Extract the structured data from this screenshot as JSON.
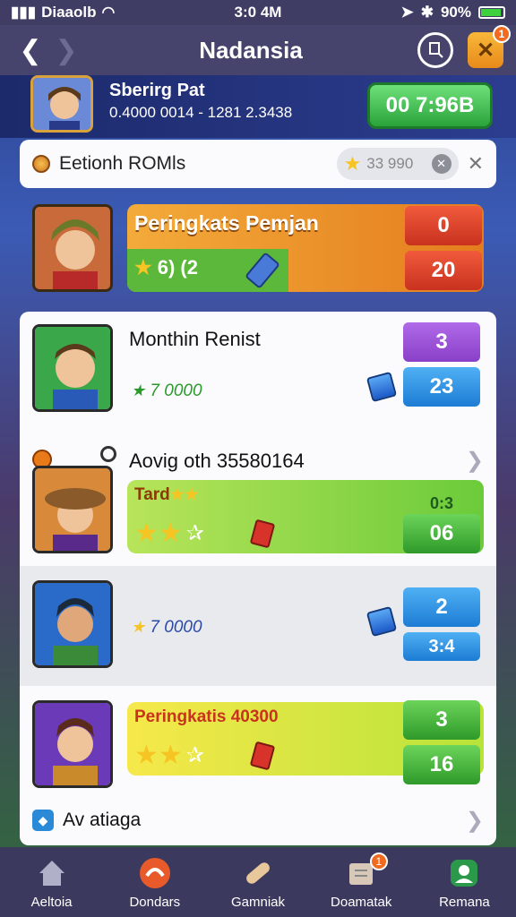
{
  "status": {
    "carrier": "Diaaolb",
    "time": "3:0 4M",
    "battery": "90%",
    "battery_level": 0.9
  },
  "nav": {
    "title": "Nadansia",
    "close_badge": "1"
  },
  "profile": {
    "name": "Sberirg Pat",
    "stats": "0.4000 0014 - 1281 2.3438",
    "timer": "00 7:96B"
  },
  "search": {
    "title": "Eetionh ROMls",
    "pill_value": "33 990"
  },
  "rank": {
    "title": "Peringkats Pemjan",
    "stats": "6) (2",
    "score_top": "0",
    "score_bottom": "20"
  },
  "entries": [
    {
      "name": "Monthin Renist",
      "points": "7 0000",
      "score_top": "3",
      "score_bottom": "23"
    },
    {
      "name": "Aovig oth 35580164",
      "bar_label": "Tard",
      "score_top": "0:3",
      "score_bottom": "06"
    },
    {
      "points": "7 0000",
      "score_top": "2",
      "score_bottom": "3:4"
    },
    {
      "bar_label": "Peringkatis 40300",
      "score_top": "3",
      "score_bottom": "16"
    }
  ],
  "footer_entry": {
    "label": "Av atiaga"
  },
  "tabs": [
    {
      "label": "Aeltoia",
      "icon": "home-icon"
    },
    {
      "label": "Dondars",
      "icon": "map-icon"
    },
    {
      "label": "Gamniak",
      "icon": "bandage-icon"
    },
    {
      "label": "Doamatak",
      "icon": "scroll-icon",
      "badge": "1"
    },
    {
      "label": "Remana",
      "icon": "profile-icon"
    }
  ],
  "colors": {
    "accent": "#46446c",
    "tab_bar": "#3b3a5e",
    "timer_green": "#2aa33a",
    "rank_orange": "#e47c1e"
  }
}
